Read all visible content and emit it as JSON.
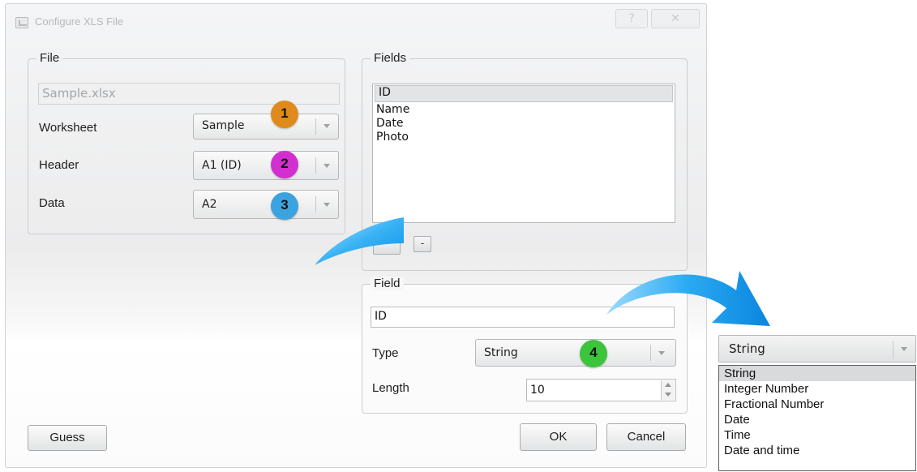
{
  "window": {
    "title": "Configure XLS File",
    "help_label": "?",
    "close_label": "✕"
  },
  "file_group": {
    "title": "File",
    "file_name": "Sample.xlsx",
    "worksheet_label": "Worksheet",
    "worksheet_value": "Sample",
    "header_label": "Header",
    "header_value": "A1 (ID)",
    "data_label": "Data",
    "data_value": "A2"
  },
  "fields_group": {
    "title": "Fields",
    "items": [
      "ID",
      "Name",
      "Date",
      "Photo"
    ],
    "selected_index": 0,
    "remove_label": "-"
  },
  "field_group": {
    "title": "Field",
    "name_value": "ID",
    "type_label": "Type",
    "type_value": "String",
    "length_label": "Length",
    "length_value": "10"
  },
  "buttons": {
    "guess": "Guess",
    "ok": "OK",
    "cancel": "Cancel"
  },
  "badges": [
    {
      "number": "1",
      "color": "#e08a1e"
    },
    {
      "number": "2",
      "color": "#d22ed0"
    },
    {
      "number": "3",
      "color": "#3aa3e0"
    },
    {
      "number": "4",
      "color": "#3cc43c"
    }
  ],
  "type_dropdown": {
    "value": "String",
    "options": [
      "String",
      "Integer Number",
      "Fractional Number",
      "Date",
      "Time",
      "Date and time"
    ],
    "selected_index": 0
  },
  "colors": {
    "arrow_blue": "#1aa3ee",
    "arrow_blue_light": "#7fd3ff"
  }
}
